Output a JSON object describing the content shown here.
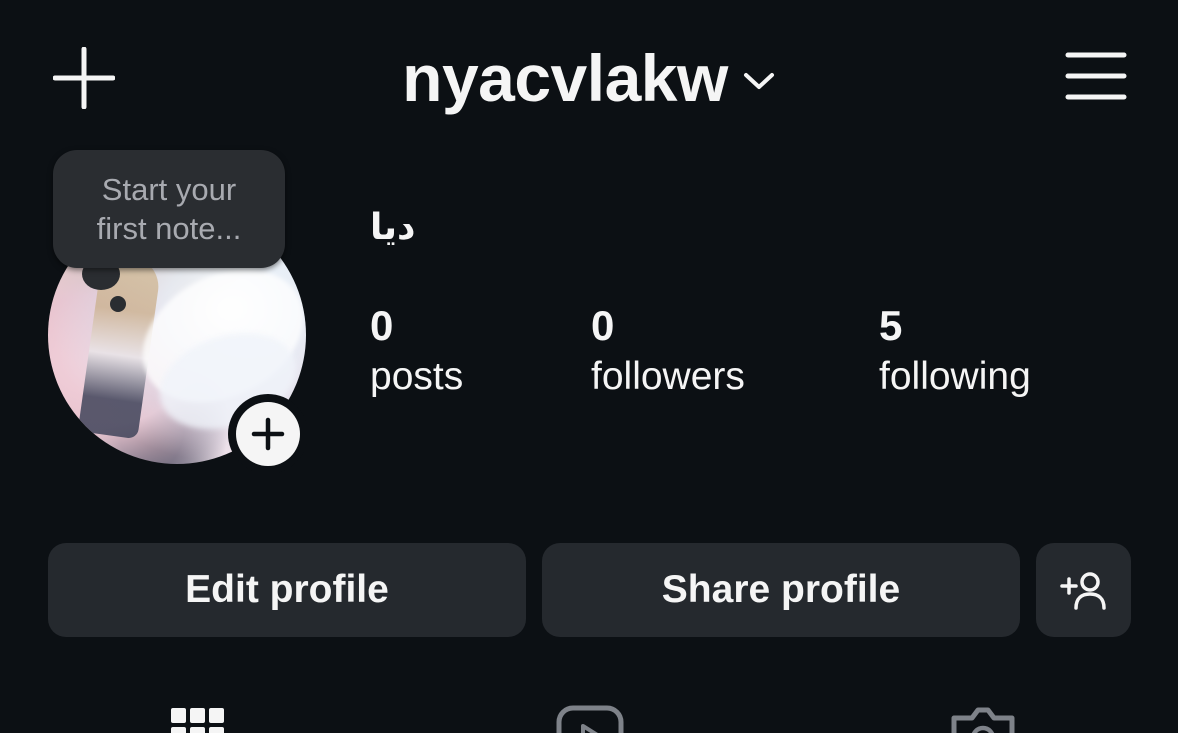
{
  "header": {
    "new_post_icon": "plus-icon",
    "username": "nyacvlakw",
    "switch_account_icon": "chevron-down-icon",
    "menu_icon": "hamburger-menu-icon"
  },
  "note": {
    "line1": "Start your",
    "line2": "first note..."
  },
  "profile": {
    "display_name": "ديا",
    "add_story_icon": "plus-icon"
  },
  "stats": {
    "posts": {
      "count": "0",
      "label": "posts"
    },
    "followers": {
      "count": "0",
      "label": "followers"
    },
    "following": {
      "count": "5",
      "label": "following"
    }
  },
  "actions": {
    "edit_label": "Edit profile",
    "share_label": "Share profile",
    "discover_icon": "add-person-icon"
  },
  "tabs": [
    {
      "icon": "grid-icon"
    },
    {
      "icon": "reels-icon"
    },
    {
      "icon": "tagged-icon"
    }
  ],
  "colors": {
    "background": "#0c1014",
    "button_bg": "#25292e",
    "text": "#f5f5f5",
    "note_bg": "#2a2d31",
    "note_text": "#a8aab0"
  }
}
